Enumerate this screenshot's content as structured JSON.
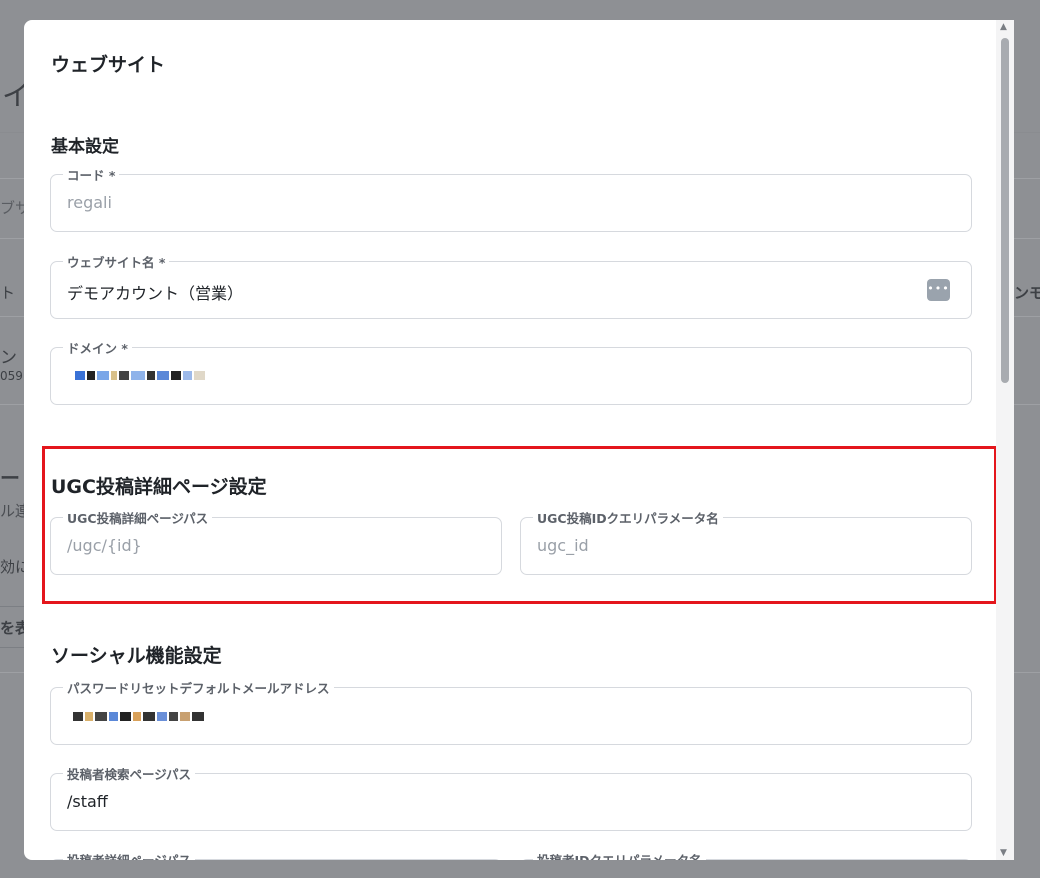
{
  "background": {
    "fragments": [
      "イ",
      "ブサ",
      "ト",
      "ン",
      "059",
      "ー",
      "ル連",
      "効に",
      "を表",
      "ンモ"
    ]
  },
  "modal": {
    "title": "ウェブサイト",
    "sections": {
      "basic": {
        "title": "基本設定",
        "code": {
          "label": "コード *",
          "placeholder": "regali"
        },
        "website_name": {
          "label": "ウェブサイト名 *",
          "value": "デモアカウント（営業）",
          "more_icon": "more-horizontal-icon"
        },
        "domain": {
          "label": "ドメイン *"
        }
      },
      "ugc": {
        "title": "UGC投稿詳細ページ設定",
        "detail_path": {
          "label": "UGC投稿詳細ページパス",
          "placeholder": "/ugc/{id}"
        },
        "id_param": {
          "label": "UGC投稿IDクエリパラメータ名",
          "placeholder": "ugc_id"
        }
      },
      "social": {
        "title": "ソーシャル機能設定",
        "reset_email": {
          "label": "パスワードリセットデフォルトメールアドレス"
        },
        "search_path": {
          "label": "投稿者検索ページパス",
          "value": "/staff"
        },
        "detail_path": {
          "label": "投稿者詳細ページパス"
        },
        "id_param": {
          "label": "投稿者IDクエリパラメータ名"
        }
      }
    }
  },
  "colors": {
    "highlight": "#e4161c",
    "overlay": "#8e9094"
  }
}
